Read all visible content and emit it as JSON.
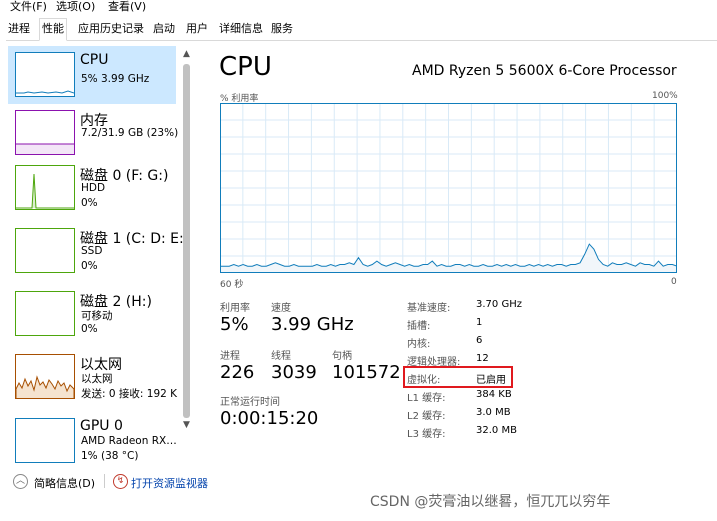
{
  "menu": {
    "file": "文件(F)",
    "options": "选项(O)",
    "view": "查看(V)"
  },
  "tabs": [
    "进程",
    "性能",
    "应用历史记录",
    "启动",
    "用户",
    "详细信息",
    "服务"
  ],
  "sidebar": [
    {
      "title": "CPU",
      "sub1": "5% 3.99 GHz",
      "sub2": "",
      "color": "#117dbb"
    },
    {
      "title": "内存",
      "sub1": "7.2/31.9 GB (23%)",
      "sub2": "",
      "color": "#8b12ae"
    },
    {
      "title": "磁盘 0 (F: G:)",
      "sub1": "HDD",
      "sub2": "0%",
      "color": "#4da60c"
    },
    {
      "title": "磁盘 1 (C: D: E:",
      "sub1": "SSD",
      "sub2": "0%",
      "color": "#4da60c"
    },
    {
      "title": "磁盘 2 (H:)",
      "sub1": "可移动",
      "sub2": "0%",
      "color": "#4da60c"
    },
    {
      "title": "以太网",
      "sub1": "以太网",
      "sub2": "发送: 0 接收: 192 K",
      "color": "#a74f01"
    },
    {
      "title": "GPU 0",
      "sub1": "AMD Radeon RX…",
      "sub2": "1% (38 °C)",
      "color": "#117dbb"
    }
  ],
  "main": {
    "title": "CPU",
    "processor": "AMD Ryzen 5 5600X 6-Core Processor",
    "graph": {
      "ylabel": "% 利用率",
      "ymax_label": "100%",
      "xlabel": "60 秒",
      "xmin_label": "0",
      "utilization_series": [
        4,
        4,
        4,
        5,
        4,
        5,
        4,
        4,
        5,
        4,
        4,
        5,
        6,
        5,
        4,
        4,
        5,
        4,
        4,
        4,
        4,
        5,
        4,
        4,
        5,
        4,
        5,
        5,
        6,
        5,
        9,
        5,
        4,
        5,
        7,
        5,
        4,
        5,
        6,
        5,
        4,
        5,
        4,
        4,
        5,
        5,
        7,
        4,
        5,
        4,
        4,
        5,
        5,
        4,
        5,
        4,
        4,
        5,
        4,
        4,
        5,
        4,
        5,
        4,
        5,
        4,
        4,
        5,
        4,
        5,
        4,
        5,
        4,
        5,
        5,
        4,
        5,
        5,
        6,
        11,
        17,
        14,
        8,
        5,
        4,
        6,
        5,
        5,
        6,
        5,
        4,
        6,
        5,
        5,
        4,
        7,
        4,
        5,
        5,
        4
      ]
    },
    "stats": {
      "util_label": "利用率",
      "util_value": "5%",
      "speed_label": "速度",
      "speed_value": "3.99 GHz",
      "proc_label": "进程",
      "proc_value": "226",
      "threads_label": "线程",
      "threads_value": "3039",
      "handles_label": "句柄",
      "handles_value": "101572",
      "uptime_label": "正常运行时间",
      "uptime_value": "0:00:15:20"
    },
    "info": [
      {
        "label": "基准速度:",
        "value": "3.70 GHz"
      },
      {
        "label": "插槽:",
        "value": "1"
      },
      {
        "label": "内核:",
        "value": "6"
      },
      {
        "label": "逻辑处理器:",
        "value": "12"
      },
      {
        "label": "虚拟化:",
        "value": "已启用"
      },
      {
        "label": "L1 缓存:",
        "value": "384 KB"
      },
      {
        "label": "L2 缓存:",
        "value": "3.0 MB"
      },
      {
        "label": "L3 缓存:",
        "value": "32.0 MB"
      }
    ]
  },
  "footer": {
    "brief": "简略信息(D)",
    "monitor": "打开资源监视器"
  },
  "watermark": "CSDN @荧膏油以继晷，恒兀兀以穷年",
  "colors": {
    "cpu": "#117dbb",
    "memory": "#8b12ae",
    "disk": "#4da60c",
    "ethernet": "#a74f01",
    "highlight": "#e0191e",
    "selected": "#cce8ff"
  }
}
